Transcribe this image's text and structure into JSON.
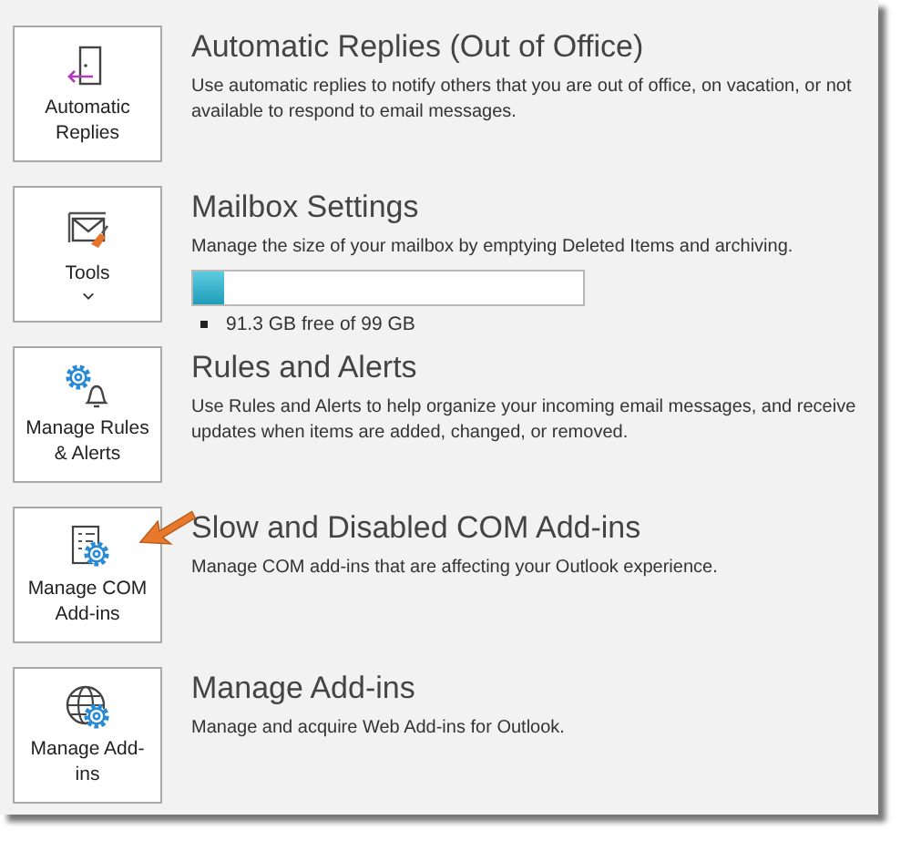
{
  "sections": [
    {
      "button": {
        "label": "Automatic\nReplies",
        "caret": false
      },
      "title": "Automatic Replies (Out of Office)",
      "description": "Use automatic replies to notify others that you are out of office, on vacation, or not available to respond to email messages."
    },
    {
      "button": {
        "label": "Tools",
        "caret": true
      },
      "title": "Mailbox Settings",
      "description": "Manage the size of your mailbox by emptying Deleted Items and archiving.",
      "meter": {
        "level": 0.08,
        "legend": "91.3 GB free of 99 GB"
      }
    },
    {
      "button": {
        "label": "Manage Rules\n& Alerts",
        "caret": false
      },
      "title": "Rules and Alerts",
      "description": "Use Rules and Alerts to help organize your incoming email messages, and receive updates when items are added, changed, or removed."
    },
    {
      "button": {
        "label": "Manage COM\nAdd-ins",
        "caret": false
      },
      "title": "Slow and Disabled COM Add-ins",
      "description": "Manage COM add-ins that are affecting your Outlook experience.",
      "pointer": true
    },
    {
      "button": {
        "label": "Manage Add-\nins",
        "caret": false
      },
      "title": "Manage Add-ins",
      "description": "Manage and acquire Web Add-ins for Outlook."
    }
  ]
}
